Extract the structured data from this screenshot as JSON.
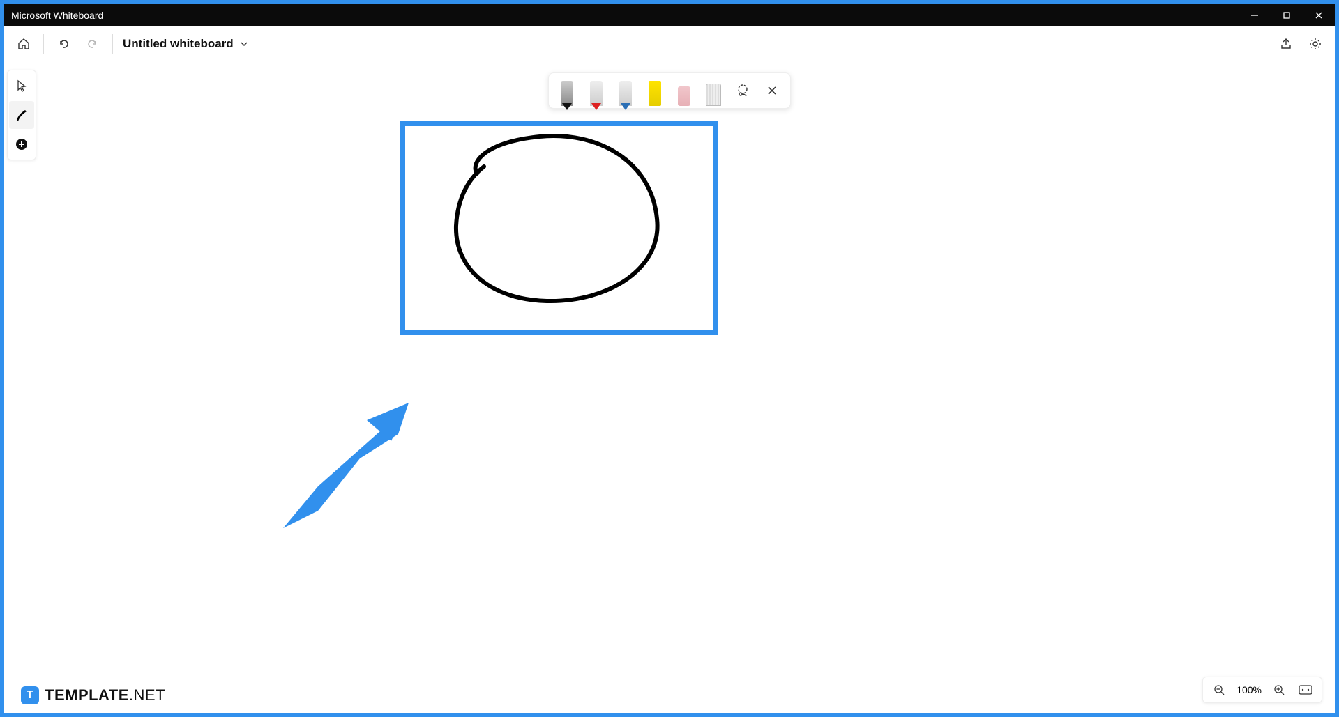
{
  "window": {
    "title": "Microsoft Whiteboard"
  },
  "header": {
    "doc_title": "Untitled whiteboard"
  },
  "side_tools": {
    "items": [
      {
        "name": "select",
        "icon": "cursor"
      },
      {
        "name": "ink",
        "icon": "pen",
        "active": true
      },
      {
        "name": "add",
        "icon": "plus"
      }
    ]
  },
  "ink_toolbar": {
    "pens": [
      {
        "name": "black-pen",
        "color": "#2b2b2b",
        "tip": "#111"
      },
      {
        "name": "red-pen",
        "color": "#d9d9d9",
        "tip": "#d22"
      },
      {
        "name": "blue-pen",
        "color": "#d9d9d9",
        "tip": "#2b6fb5"
      },
      {
        "name": "highlighter-yellow",
        "color": "#ffe400",
        "tip": "#ffe400",
        "kind": "highlighter"
      },
      {
        "name": "eraser",
        "color": "#e7b0b6",
        "tip": "#e7b0b6",
        "kind": "eraser"
      },
      {
        "name": "ruler",
        "color": "#d9d9d9",
        "tip": "#bbb",
        "kind": "ruler"
      }
    ],
    "tools": [
      {
        "name": "lasso",
        "icon": "lasso"
      },
      {
        "name": "close",
        "icon": "x"
      }
    ]
  },
  "zoom": {
    "value": "100%"
  },
  "watermark": {
    "brand_strong": "TEMPLATE",
    "brand_thin": ".NET"
  },
  "annotation": {
    "highlight_color": "#3190ed"
  }
}
